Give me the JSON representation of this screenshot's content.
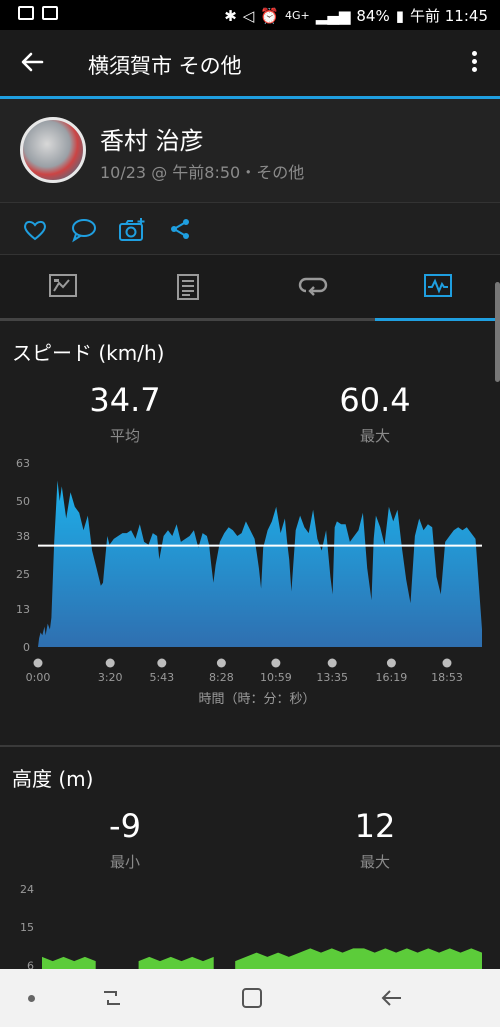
{
  "status_bar": {
    "lte": "4G+",
    "battery": "84%",
    "time": "午前 11:45"
  },
  "app_bar": {
    "title": "横須賀市 その他"
  },
  "profile": {
    "name": "香村 治彦",
    "meta": "10/23 @ 午前8:50・その他"
  },
  "speed": {
    "title": "スピード (km/h)",
    "avg_value": "34.7",
    "avg_label": "平均",
    "max_value": "60.4",
    "max_label": "最大"
  },
  "altitude": {
    "title": "高度 (m)",
    "min_value": "-9",
    "min_label": "最小",
    "max_value": "12",
    "max_label": "最大"
  },
  "colors": {
    "accent": "#1f9fe0",
    "speed_fill": "#2a8fd0",
    "altitude_fill": "#5ccc3a",
    "avg_line": "#ffffff"
  },
  "chart_data": [
    {
      "type": "area",
      "title": "スピード (km/h)",
      "xlabel": "時間（時：分：秒）",
      "ylabel": "",
      "yticks": [
        "0",
        "13",
        "25",
        "38",
        "50",
        "63"
      ],
      "xticks": [
        "0:00",
        "3:20",
        "5:43",
        "8:28",
        "10:59",
        "13:35",
        "16:19",
        "18:53"
      ],
      "ylim": [
        0,
        63
      ],
      "avg_line": 34.7,
      "series": [
        {
          "x": [
            0,
            0.05,
            0.12,
            0.2,
            0.3,
            0.35,
            0.45,
            0.55,
            0.62,
            0.75,
            0.9,
            1.0,
            1.1,
            1.3,
            1.5,
            1.7,
            1.9,
            2.1,
            2.3,
            2.5,
            2.7,
            2.9,
            3.0,
            3.1,
            3.2,
            3.3,
            3.4,
            3.5,
            3.7,
            3.9,
            4.1,
            4.3,
            4.5,
            4.7,
            4.9,
            5.1,
            5.3,
            5.5,
            5.6,
            5.8,
            6.0,
            6.2,
            6.4,
            6.6,
            6.8,
            7.0,
            7.2,
            7.4,
            7.6,
            7.8,
            7.9,
            8.0,
            8.1,
            8.2,
            8.4,
            8.6,
            8.8,
            9.0,
            9.2,
            9.4,
            9.6,
            9.8,
            10.0,
            10.1,
            10.2,
            10.3,
            10.4,
            10.6,
            10.8,
            11.0,
            11.2,
            11.4,
            11.5,
            11.6,
            11.7,
            11.9,
            12.1,
            12.3,
            12.5,
            12.7,
            12.9,
            13.1,
            13.3,
            13.5,
            13.6,
            13.7,
            13.8,
            14.0,
            14.2,
            14.4,
            14.6,
            14.8,
            15.0,
            15.2,
            15.4,
            15.5,
            15.6,
            15.8,
            16.0,
            16.2,
            16.4,
            16.6,
            16.8,
            17.0,
            17.2,
            17.4,
            17.6,
            17.8,
            18.0,
            18.2,
            18.4,
            18.6,
            18.8,
            19.0,
            19.2,
            19.4,
            19.6,
            19.8,
            20.0,
            20.2,
            20.5
          ],
          "values": [
            0,
            3,
            5,
            4,
            7,
            4,
            8,
            6,
            10,
            36,
            57,
            50,
            55,
            44,
            53,
            48,
            46,
            40,
            45,
            33,
            27,
            21,
            22,
            30,
            38,
            35,
            36,
            37,
            38,
            39,
            39,
            40,
            37,
            42,
            36,
            35,
            39,
            38,
            30,
            38,
            40,
            38,
            42,
            36,
            37,
            38,
            40,
            34,
            39,
            38,
            35,
            28,
            22,
            28,
            36,
            39,
            41,
            40,
            38,
            39,
            43,
            40,
            37,
            32,
            27,
            20,
            34,
            40,
            43,
            48,
            39,
            44,
            36,
            30,
            19,
            40,
            45,
            41,
            39,
            47,
            37,
            33,
            40,
            24,
            18,
            41,
            43,
            42,
            42,
            36,
            38,
            40,
            46,
            27,
            16,
            37,
            45,
            41,
            35,
            48,
            43,
            47,
            34,
            23,
            15,
            38,
            44,
            40,
            42,
            41,
            24,
            18,
            36,
            38,
            40,
            41,
            40,
            41,
            39,
            37,
            6
          ]
        }
      ]
    },
    {
      "type": "area",
      "title": "高度 (m)",
      "yticks": [
        "6",
        "15",
        "24"
      ],
      "ylim": [
        -9,
        24
      ],
      "series": [
        {
          "values": [
            8,
            7,
            8,
            7,
            8,
            7,
            null,
            null,
            null,
            7,
            8,
            7,
            8,
            7,
            8,
            7,
            8,
            null,
            7,
            8,
            9,
            8,
            9,
            8,
            9,
            10,
            9,
            10,
            9,
            10,
            10,
            9,
            10,
            9,
            10,
            9,
            10,
            9,
            10,
            9,
            10,
            9
          ]
        }
      ]
    }
  ]
}
